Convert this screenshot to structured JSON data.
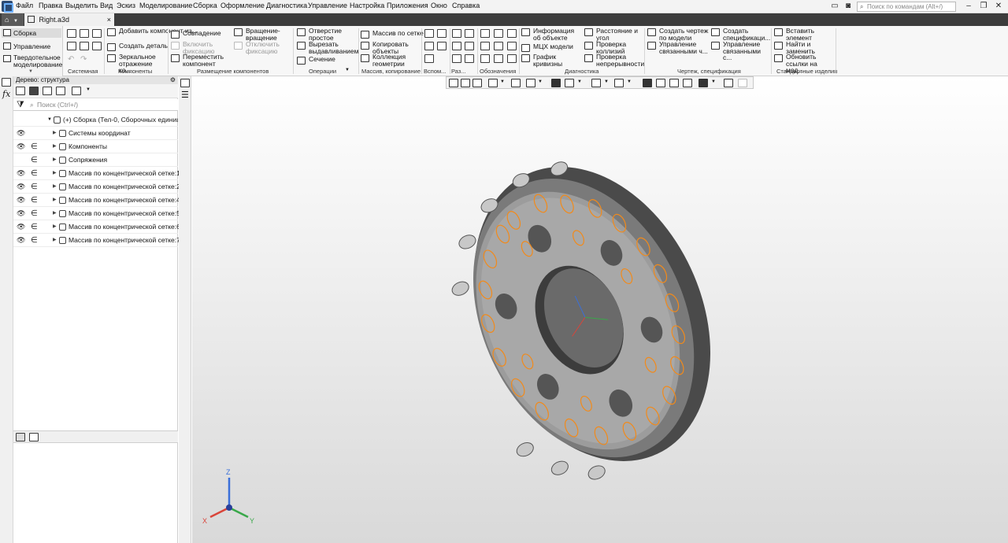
{
  "menu": [
    "Файл",
    "Правка",
    "Выделить",
    "Вид",
    "Эскиз",
    "Моделирование",
    "Сборка",
    "Оформление",
    "Диагностика",
    "Управление",
    "Настройка",
    "Приложения",
    "Окно",
    "Справка"
  ],
  "search": {
    "placeholder": "Поиск по командам (Alt+/)"
  },
  "tabs": {
    "home_label": "▼",
    "doc_title": "Right.a3d",
    "close": "×"
  },
  "sidebar": {
    "items": [
      {
        "label": "Сборка",
        "active": true
      },
      {
        "label": "Управление"
      },
      {
        "label": "Твердотельное моделирование"
      }
    ]
  },
  "ribbon": {
    "system": {
      "label": "Системная"
    },
    "components": {
      "label": "Компоненты",
      "add": "Добавить компонент из...",
      "create_part": "Создать деталь",
      "mirror": "Зеркальное отражение ко..."
    },
    "placement": {
      "label": "Размещение компонентов",
      "coincide": "Совпадение",
      "rotation": "Вращение-вращение",
      "enable_fix": "Включить фиксацию",
      "disable_fix": "Отключить фиксацию",
      "move": "Переместить компонент"
    },
    "operations": {
      "label": "Операции",
      "hole": "Отверстие простое",
      "extrude_cut": "Вырезать выдавливанием",
      "section": "Сечение"
    },
    "arrays": {
      "label": "Массив, копирование",
      "grid": "Массив по сетке",
      "copy": "Копировать объекты",
      "collection": "Коллекция геометрии"
    },
    "aux": {
      "label": "Вспом..."
    },
    "sizes": {
      "label": "Раз..."
    },
    "notes": {
      "label": "Обозначения"
    },
    "diagnostics": {
      "label": "Диагностика",
      "info": "Информация об объекте",
      "mass": "МЦХ модели",
      "curvature": "График кривизны",
      "distance": "Расстояние и угол",
      "collisions": "Проверка коллизий",
      "continuity": "Проверка непрерывности"
    },
    "drawing": {
      "label": "Чертеж, спецификация",
      "create_drawing": "Создать чертеж по модели",
      "manage_linked": "Управление связанными ч...",
      "create_spec": "Создать спецификаци...",
      "manage_spec": "Управление связанными с..."
    },
    "standard": {
      "label": "Стандартные изделия",
      "insert": "Вставить элемент",
      "find_replace": "Найти и заменить",
      "update_links": "Обновить ссылки на мод..."
    }
  },
  "tree": {
    "title": "Дерево: структура",
    "search_placeholder": "Поиск (Ctrl+/)",
    "root": "(+) Сборка (Тел-0, Сборочных единиц-0",
    "rows": [
      {
        "label": "Системы координат",
        "eye": true,
        "incl": false
      },
      {
        "label": "Компоненты",
        "eye": true,
        "incl": true
      },
      {
        "label": "Сопряжения",
        "eye": false,
        "incl": true
      },
      {
        "label": "Массив по концентрической сетке:1",
        "eye": true,
        "incl": true
      },
      {
        "label": "Массив по концентрической сетке:2",
        "eye": true,
        "incl": true
      },
      {
        "label": "Массив по концентрической сетке:4",
        "eye": true,
        "incl": true
      },
      {
        "label": "Массив по концентрической сетке:5",
        "eye": true,
        "incl": true
      },
      {
        "label": "Массив по концентрической сетке:6",
        "eye": true,
        "incl": true
      },
      {
        "label": "Массив по концентрической сетке:7",
        "eye": true,
        "incl": true
      }
    ]
  },
  "axes": {
    "x": "X",
    "y": "Y",
    "z": "Z"
  },
  "colors": {
    "accent": "#f28a1a",
    "menu_bg": "#f3f3f3",
    "tab_strip": "#3c3c3c",
    "x_axis": "#d9453a",
    "y_axis": "#3aa84a",
    "z_axis": "#3a6fd9"
  }
}
